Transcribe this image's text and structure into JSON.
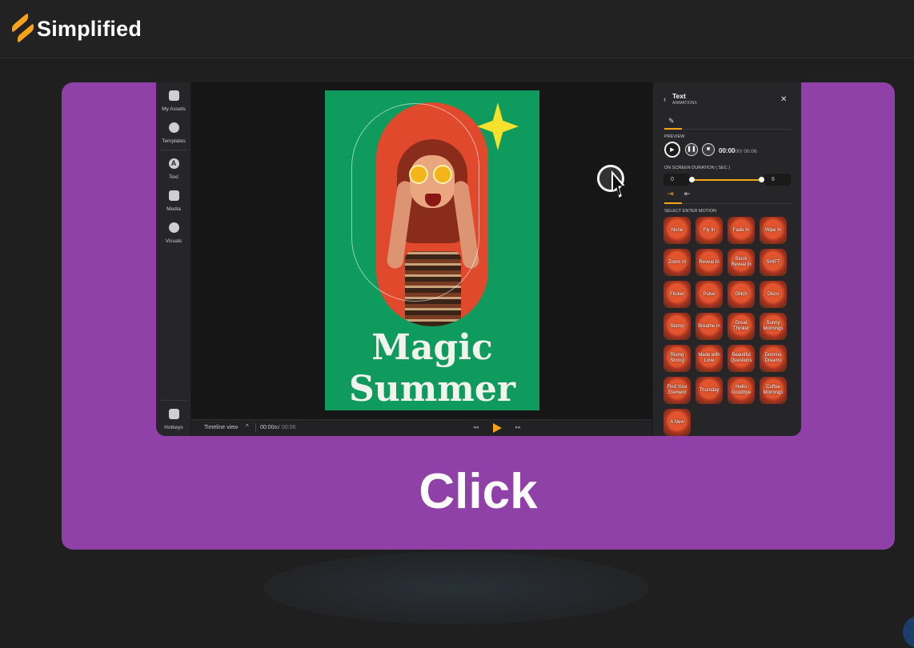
{
  "brand": {
    "name": "Simplified",
    "accent": "#f7a21b"
  },
  "card": {
    "bg": "#8f41a8",
    "caption": "Click"
  },
  "sidebar": {
    "items": [
      {
        "label": "My Assets",
        "icon": "folder-icon"
      },
      {
        "label": "Templates",
        "icon": "templates-icon"
      },
      {
        "label": "Text",
        "icon": "text-icon"
      },
      {
        "label": "Media",
        "icon": "media-icon"
      },
      {
        "label": "Visuals",
        "icon": "visuals-icon"
      }
    ],
    "hotkeys": "Hotkeys"
  },
  "poster": {
    "line1": "Magic",
    "line2": "Summer",
    "bg": "#0f9a5e"
  },
  "timeline": {
    "label": "Timeline view",
    "current": "00:00",
    "current_frac": "00",
    "total": "/ 00:06"
  },
  "panel": {
    "title": "Text",
    "subtitle": "ANIMATIONS",
    "preview_label": "PREVIEW",
    "time_current": "00:00",
    "time_frac": "00",
    "time_total": "/ 00:06",
    "duration_label": "ON SCREEN DURATION ( SEC )",
    "duration_start": "0",
    "duration_end": "6",
    "select_label": "SELECT ENTER MOTION",
    "motions": [
      "None",
      "Fly In",
      "Fade In",
      "Wipe In",
      "Zoom In",
      "Reveal In",
      "Block Reveal In",
      "SHIFT",
      "Flicker",
      "Pulse",
      "Glitch",
      "Disco",
      "Stomp",
      "Breathe In",
      "Great Thinker",
      "Sunny Mornings",
      "Rising Strong",
      "Made with Love",
      "Beautiful Questions",
      "Domino Dreams",
      "Find Your Element",
      "Thursday",
      "Hello Goodbye",
      "Coffee Mornings",
      "A New"
    ]
  }
}
